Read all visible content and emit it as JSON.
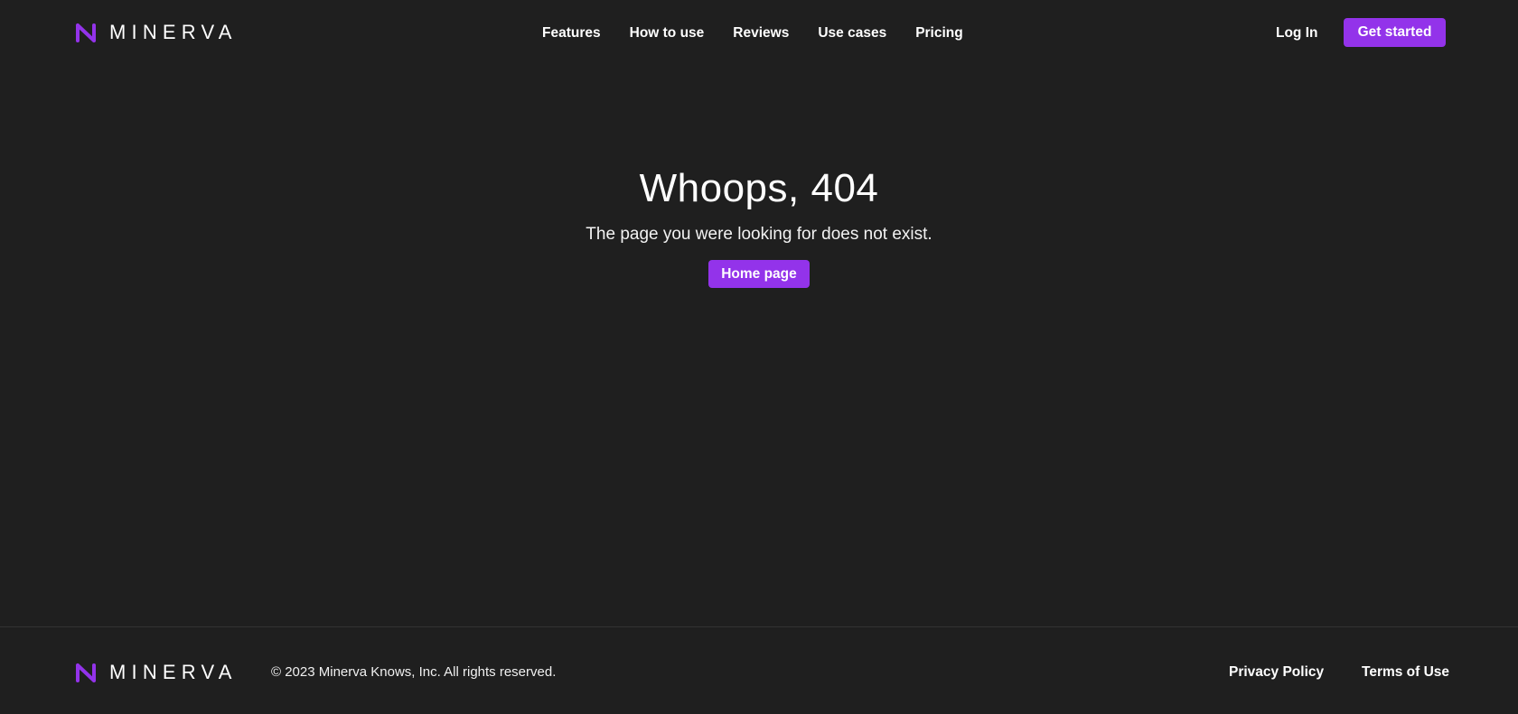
{
  "brand": {
    "name": "MINERVA",
    "logo_icon": "minerva-ribbon-logo-icon",
    "accent_color": "#9333ea",
    "background_color": "#1f1f1f"
  },
  "header": {
    "nav": [
      {
        "label": "Features"
      },
      {
        "label": "How to use"
      },
      {
        "label": "Reviews"
      },
      {
        "label": "Use cases"
      },
      {
        "label": "Pricing"
      }
    ],
    "login_label": "Log In",
    "cta_label": "Get started"
  },
  "main": {
    "title": "Whoops, 404",
    "message": "The page you were looking for does not exist.",
    "home_button_label": "Home page"
  },
  "footer": {
    "copyright": "© 2023 Minerva Knows, Inc. All rights reserved.",
    "links": [
      {
        "label": "Privacy Policy"
      },
      {
        "label": "Terms of Use"
      }
    ]
  }
}
